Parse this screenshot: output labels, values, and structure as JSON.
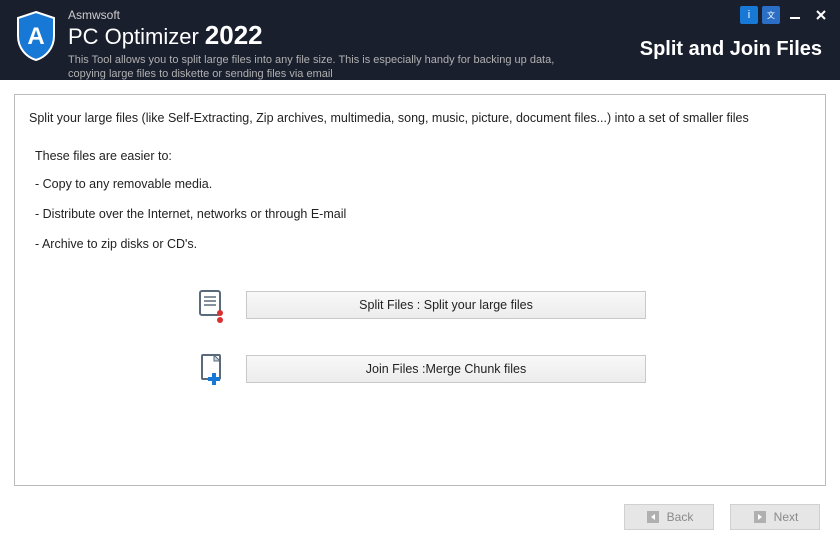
{
  "header": {
    "brand": "Asmwsoft",
    "app_name": "PC Optimizer",
    "year": "2022",
    "description": "This Tool allows you to split large files into any file size. This is especially handy for backing up data, copying large files to diskette or sending files via email",
    "feature_title": "Split and Join Files"
  },
  "panel": {
    "intro": "Split your large files (like Self-Extracting, Zip archives, multimedia, song, music, picture, document files...) into a set of smaller files",
    "subhead": "These files are easier to:",
    "bullets": [
      "- Copy to any removable media.",
      "- Distribute over the Internet, networks or through E-mail",
      "- Archive to zip disks or CD's."
    ],
    "split_button": "Split Files : Split your large files",
    "join_button": "Join Files :Merge Chunk files"
  },
  "footer": {
    "back": "Back",
    "next": "Next"
  }
}
